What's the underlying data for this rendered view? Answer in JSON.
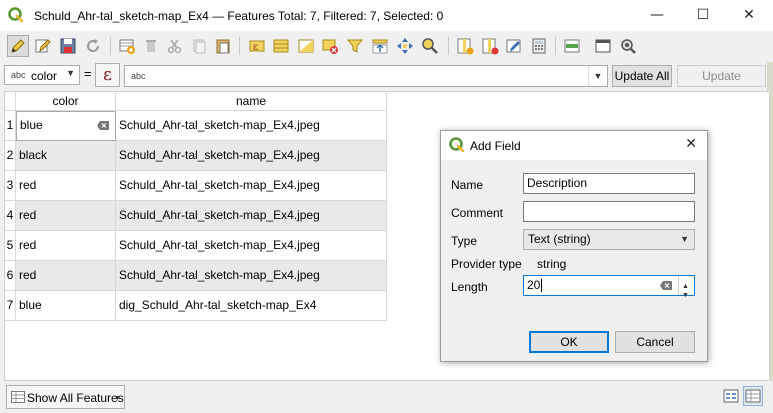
{
  "window": {
    "title": "Schuld_Ahr-tal_sketch-map_Ex4 — Features Total: 7, Filtered: 7, Selected: 0",
    "minimize": "—",
    "maximize": "☐",
    "close": "✕"
  },
  "toolbar": {
    "icons": [
      "toggle-editing-icon",
      "multi-edit-icon",
      "save-edits-icon",
      "reload-icon",
      "add-feature-icon",
      "delete-feature-icon",
      "cut-icon",
      "copy-icon",
      "paste-icon",
      "select-by-expression-icon",
      "select-all-icon",
      "invert-selection-icon",
      "deselect-all-icon",
      "filter-select-icon",
      "move-selection-top-icon",
      "pan-to-selection-icon",
      "zoom-to-selection-icon",
      "new-field-icon",
      "delete-field-icon",
      "organize-columns-icon",
      "field-calculator-icon",
      "conditional-formatting-icon",
      "dock-table-icon",
      "actions-icon"
    ]
  },
  "expression_bar": {
    "field_type_tag": "abc",
    "field": "color",
    "equals": "=",
    "epsilon": "ε",
    "input_type_tag": "abc",
    "input_value": "",
    "update_all": "Update All",
    "update_selected": "Update Selected"
  },
  "table": {
    "columns": [
      "color",
      "name"
    ],
    "rows": [
      {
        "num": "1",
        "color": "blue",
        "name": "Schuld_Ahr-tal_sketch-map_Ex4.jpeg"
      },
      {
        "num": "2",
        "color": "black",
        "name": "Schuld_Ahr-tal_sketch-map_Ex4.jpeg"
      },
      {
        "num": "3",
        "color": "red",
        "name": "Schuld_Ahr-tal_sketch-map_Ex4.jpeg"
      },
      {
        "num": "4",
        "color": "red",
        "name": "Schuld_Ahr-tal_sketch-map_Ex4.jpeg"
      },
      {
        "num": "5",
        "color": "red",
        "name": "Schuld_Ahr-tal_sketch-map_Ex4.jpeg"
      },
      {
        "num": "6",
        "color": "red",
        "name": "Schuld_Ahr-tal_sketch-map_Ex4.jpeg"
      },
      {
        "num": "7",
        "color": "blue",
        "name": "dig_Schuld_Ahr-tal_sketch-map_Ex4"
      }
    ]
  },
  "footer": {
    "show_all": "Show All Features"
  },
  "dialog": {
    "title": "Add Field",
    "close": "✕",
    "name_label": "Name",
    "name_value": "Description",
    "comment_label": "Comment",
    "comment_value": "",
    "type_label": "Type",
    "type_value": "Text (string)",
    "provider_type_label": "Provider type",
    "provider_type_value": "string",
    "length_label": "Length",
    "length_value": "20",
    "ok": "OK",
    "cancel": "Cancel"
  },
  "colors": {
    "accent": "#0078d7",
    "qgis_green": "#589632",
    "alt_row": "#e9e9e9"
  }
}
